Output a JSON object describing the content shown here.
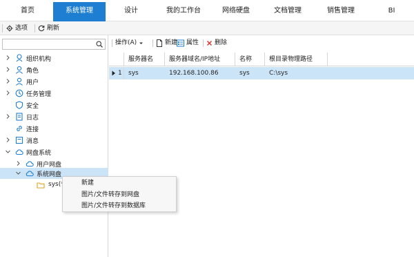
{
  "tabs": [
    {
      "label": "首页",
      "active": false
    },
    {
      "label": "系统管理",
      "active": true
    },
    {
      "label": "设计",
      "active": false
    },
    {
      "label": "我的工作台",
      "active": false
    },
    {
      "label": "网络硬盘",
      "active": false
    },
    {
      "label": "文档管理",
      "active": false
    },
    {
      "label": "销售管理",
      "active": false
    },
    {
      "label": "BI",
      "active": false
    }
  ],
  "toolbar": {
    "options_label": "选项",
    "refresh_label": "刷新"
  },
  "search": {
    "value": "",
    "placeholder": ""
  },
  "tree": {
    "items": [
      {
        "label": "组织机构",
        "icon": "org-icon"
      },
      {
        "label": "角色",
        "icon": "role-icon"
      },
      {
        "label": "用户",
        "icon": "user-icon"
      },
      {
        "label": "任务管理",
        "icon": "clock-icon"
      },
      {
        "label": "安全",
        "icon": "shield-icon"
      },
      {
        "label": "日志",
        "icon": "log-icon"
      },
      {
        "label": "连接",
        "icon": "link-icon"
      },
      {
        "label": "消息",
        "icon": "message-icon"
      },
      {
        "label": "网盘系统",
        "icon": "cloud-icon"
      },
      {
        "label": "用户网盘",
        "icon": "cloud-icon"
      },
      {
        "label": "系统网盘",
        "icon": "cloud-icon"
      },
      {
        "label": "sys(*",
        "icon": "folder-icon"
      }
    ]
  },
  "actions": {
    "operate_label": "操作(A)",
    "new_label": "新建",
    "props_label": "属性",
    "delete_label": "删除"
  },
  "grid": {
    "columns": [
      "服务器名",
      "服务器域名/IP地址",
      "名称",
      "根目录物理路径"
    ],
    "rows": [
      {
        "index": "1",
        "server": "sys",
        "ip": "192.168.100.86",
        "name": "sys",
        "path": "C:\\sys"
      }
    ]
  },
  "context_menu": {
    "items": [
      "新建",
      "图片/文件转存到网盘",
      "图片/文件转存到数据库"
    ]
  },
  "colors": {
    "accent": "#1e7ed1",
    "selection": "#cce4f7"
  }
}
